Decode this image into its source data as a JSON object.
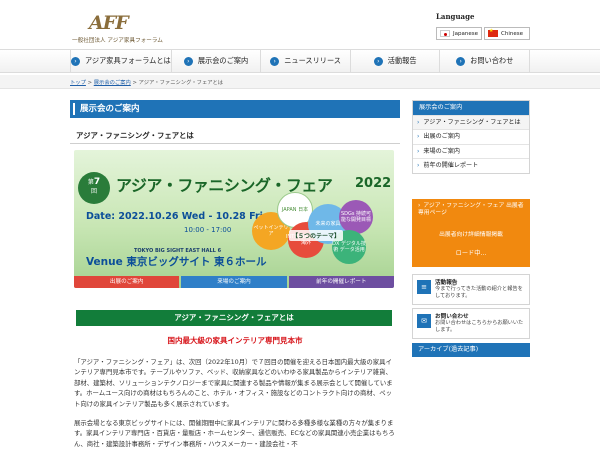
{
  "header": {
    "logo_mark": "AFF",
    "logo_sub": "一般社団法人 アジア家具フォーラム",
    "language_title": "Language",
    "languages": [
      "Japanese",
      "Chinese"
    ]
  },
  "nav": {
    "items": [
      "アジア家具フォーラムとは",
      "展示会のご案内",
      "ニュースリリース",
      "活動報告",
      "お問い合わせ"
    ]
  },
  "breadcrumb": {
    "home": "トップ",
    "sep1": " > ",
    "parent": "展示会のご案内",
    "sep2": " > ",
    "current": "アジア・ファニシング・フェアとは"
  },
  "main": {
    "page_title": "展示会のご案内",
    "section_title": "アジア・ファニシング・フェアとは",
    "fair_heading": "アジア・ファニシング・フェアとは",
    "sub_heading": "国内最大級の家具インテリア専門見本市",
    "paragraph1": "「アジア・ファニシング・フェア」は、次回（2022年10月）で７回目の開催を迎える日本国内最大級の家具インテリア専門見本市です。テーブルやソファ、ベッド、収納家具などのいわゆる家具製品からインテリア雑貨、部材、建築材、ソリューションテクノロジーまで家具に関連する製品や情報が集まる展示会として開催しています。ホームユース向けの商材はもちろんのこと、ホテル・オフィス・施設などのコントラクト向けの商材、ペット向けの家具インテリア製品も多く展示されています。",
    "paragraph2": "展示会場となる東京ビッグサイトには、開催期間中に家具インテリアに関わる多種多様な業種の方々が集まります。家具インテリア専門店・百貨店・量販店・ホームセンター、通信販売、ECなどの家具関連小売企業はもちろん、商社・建築設計事務所・デザイン事務所・ハウスメーカー・建設会社・不"
  },
  "banner": {
    "edition_label": "第",
    "edition_number": "7",
    "edition_suffix": "回",
    "title": "アジア・ファニシング・フェア",
    "year": "2022",
    "date": "Date: 2022.10.26 Wed - 10.28 Fri",
    "time": "10:00 - 17:00",
    "venue_en": "TOKYO BIG SIGHT   EAST HALL 6",
    "venue": "Venue 東京ビッグサイト 東６ホール",
    "theme": "【５つのテーマ】",
    "bubbles": [
      "ペットインテリア",
      "JAPAN 日本",
      "INTERNATIONAL 海外",
      "SDGs 持続可能な開発目標",
      "DX デジタル技術 データ活用",
      "未来の家具"
    ],
    "buttons": [
      "出展のご案内",
      "来場のご案内",
      "前年の開催レポート"
    ]
  },
  "sidebar": {
    "head": "展示会のご案内",
    "items": [
      "アジア・ファニシング・フェアとは",
      "出展のご案内",
      "来場のご案内",
      "前年の開催レポート"
    ],
    "orange_title": "アジア・ファニシング・フェア 出展者専用ページ",
    "orange_sub": "出展者向け詳細情報掲載",
    "orange_link": "ロード中...",
    "card1_title": "活動報告",
    "card1_text": "今まで行ってきた活動の紹介と報告をしております。",
    "card2_title": "お問い合わせ",
    "card2_text": "お問い合わせはこちらからお願いいたします。",
    "archive": "アーカイブ(過去記事)"
  },
  "colors": {
    "accent": "#1f73b7",
    "green": "#127d3a",
    "red": "#d7141a",
    "orange": "#f1890f"
  }
}
